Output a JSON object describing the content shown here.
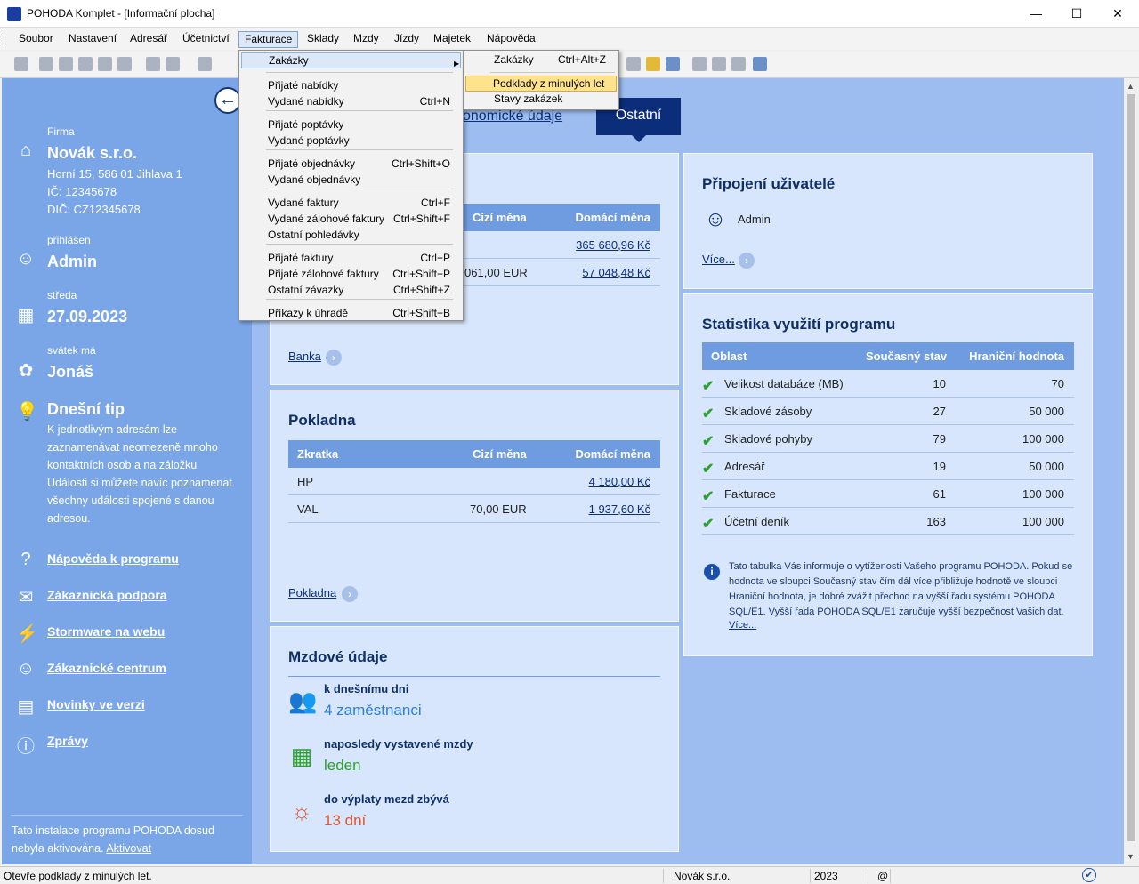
{
  "window": {
    "title": "POHODA Komplet - [Informační plocha]",
    "min": "—",
    "max": "☐",
    "close": "✕"
  },
  "menu": [
    "Soubor",
    "Nastavení",
    "Adresář",
    "Účetnictví",
    "Fakturace",
    "Sklady",
    "Mzdy",
    "Jízdy",
    "Majetek",
    "Nápověda"
  ],
  "fakturace_menu": {
    "items": [
      {
        "label": "Zakázky",
        "shortcut": ""
      },
      {
        "label": "Přijaté nabídky",
        "shortcut": ""
      },
      {
        "label": "Vydané nabídky",
        "shortcut": "Ctrl+N"
      },
      {
        "label": "Přijaté poptávky",
        "shortcut": ""
      },
      {
        "label": "Vydané poptávky",
        "shortcut": ""
      },
      {
        "label": "Přijaté objednávky",
        "shortcut": "Ctrl+Shift+O"
      },
      {
        "label": "Vydané objednávky",
        "shortcut": ""
      },
      {
        "label": "Vydané faktury",
        "shortcut": "Ctrl+F"
      },
      {
        "label": "Vydané zálohové faktury",
        "shortcut": "Ctrl+Shift+F"
      },
      {
        "label": "Ostatní pohledávky",
        "shortcut": ""
      },
      {
        "label": "Přijaté faktury",
        "shortcut": "Ctrl+P"
      },
      {
        "label": "Přijaté zálohové faktury",
        "shortcut": "Ctrl+Shift+P"
      },
      {
        "label": "Ostatní závazky",
        "shortcut": "Ctrl+Shift+Z"
      },
      {
        "label": "Příkazy k úhradě",
        "shortcut": "Ctrl+Shift+B"
      }
    ],
    "submenu_arrow": "▶"
  },
  "zakazky_submenu": {
    "items": [
      {
        "label": "Zakázky",
        "shortcut": "Ctrl+Alt+Z"
      },
      {
        "label": "Podklady z minulých let",
        "shortcut": ""
      },
      {
        "label": "Stavy zakázek",
        "shortcut": ""
      }
    ]
  },
  "sidebar": {
    "back": "←",
    "firma_label": "Firma",
    "firma_name": "Novák s.r.o.",
    "firma_address": "Horní 15, 586 01 Jihlava 1",
    "firma_ic": "IČ: 12345678",
    "firma_dic": "DIČ: CZ12345678",
    "prihlasen_label": "přihlášen",
    "user": "Admin",
    "day_label": "středa",
    "date": "27.09.2023",
    "svatek_label": "svátek má",
    "svatek_name": "Jonáš",
    "tip_title": "Dnešní tip",
    "tip_text": "K jednotlivým adresám lze zaznamenávat neomezeně mnoho kontaktních osob a na záložku Události si můžete navíc poznamenat všechny události spojené s danou adresou.",
    "links": [
      "Nápověda k programu",
      "Zákaznická podpora",
      "Stormware na webu",
      "Zákaznické centrum",
      "Novinky ve verzi",
      "Zprávy"
    ],
    "footer_text": "Tato instalace programu POHODA dosud nebyla aktivována.",
    "footer_link": "Aktivovat"
  },
  "tabs": {
    "economic": "onomické údaje",
    "active": "Ostatní"
  },
  "banka": {
    "headers": [
      "Cizí měna",
      "Domácí měna"
    ],
    "rows": [
      {
        "foreign": "",
        "domestic": "365 680,96 Kč"
      },
      {
        "foreign": "061,00 EUR",
        "domestic": "57 048,48 Kč"
      }
    ],
    "link": "Banka"
  },
  "pokladna": {
    "title": "Pokladna",
    "headers": [
      "Zkratka",
      "Cizí měna",
      "Domácí měna"
    ],
    "rows": [
      {
        "code": "HP",
        "foreign": "",
        "domestic": "4 180,00 Kč"
      },
      {
        "code": "VAL",
        "foreign": "70,00 EUR",
        "domestic": "1 937,60 Kč"
      }
    ],
    "link": "Pokladna"
  },
  "mzdy": {
    "title": "Mzdové údaje",
    "employees_label": "k dnešnímu dni",
    "employees_value": "4 zaměstnanci",
    "last_label": "naposledy vystavené mzdy",
    "last_value": "leden",
    "remaining_label": "do výplaty mezd zbývá",
    "remaining_value": "13 dní",
    "colors": {
      "employees": "#2b7de0",
      "last": "#2ea12e",
      "remaining": "#e0562b"
    }
  },
  "users": {
    "title": "Připojení uživatelé",
    "user": "Admin",
    "more": "Více..."
  },
  "stats": {
    "title": "Statistika využití programu",
    "headers": [
      "Oblast",
      "Současný stav",
      "Hraniční hodnota"
    ],
    "rows": [
      {
        "area": "Velikost databáze (MB)",
        "current": "10",
        "limit": "70"
      },
      {
        "area": "Skladové zásoby",
        "current": "27",
        "limit": "50 000"
      },
      {
        "area": "Skladové pohyby",
        "current": "79",
        "limit": "100 000"
      },
      {
        "area": "Adresář",
        "current": "19",
        "limit": "50 000"
      },
      {
        "area": "Fakturace",
        "current": "61",
        "limit": "100 000"
      },
      {
        "area": "Účetní deník",
        "current": "163",
        "limit": "100 000"
      }
    ],
    "check": "✔",
    "info": "Tato tabulka Vás informuje o vytíženosti Vašeho programu POHODA. Pokud se hodnota ve sloupci Současný stav čím dál více přibližuje hodnotě ve sloupci Hraniční hodnota, je dobré zvážit přechod na vyšší řadu systému POHODA SQL/E1. Vyšší řada POHODA SQL/E1 zaručuje vyšší bezpečnost Vašich dat.",
    "more": "Více..."
  },
  "status": {
    "message": "Otevře podklady z minulých let.",
    "company": "Novák  s.r.o.",
    "year": "2023",
    "at": "@"
  }
}
